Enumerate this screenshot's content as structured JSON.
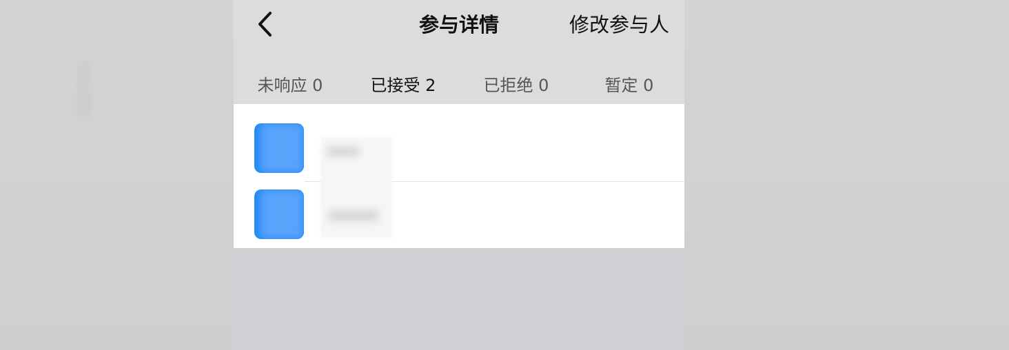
{
  "header": {
    "back_icon": "chevron-left-icon",
    "title": "参与详情",
    "edit_label": "修改参与人"
  },
  "tabs": [
    {
      "label": "未响应 0",
      "active": false
    },
    {
      "label": "已接受 2",
      "active": true
    },
    {
      "label": "已拒绝 0",
      "active": false
    },
    {
      "label": "暂定 0",
      "active": false
    }
  ],
  "participants_visible_count": 2,
  "colors": {
    "accent": "#1a88f6",
    "header_bg": "#dcdcdc",
    "list_bg": "#ffffff",
    "page_bg": "#cfcfd3"
  }
}
